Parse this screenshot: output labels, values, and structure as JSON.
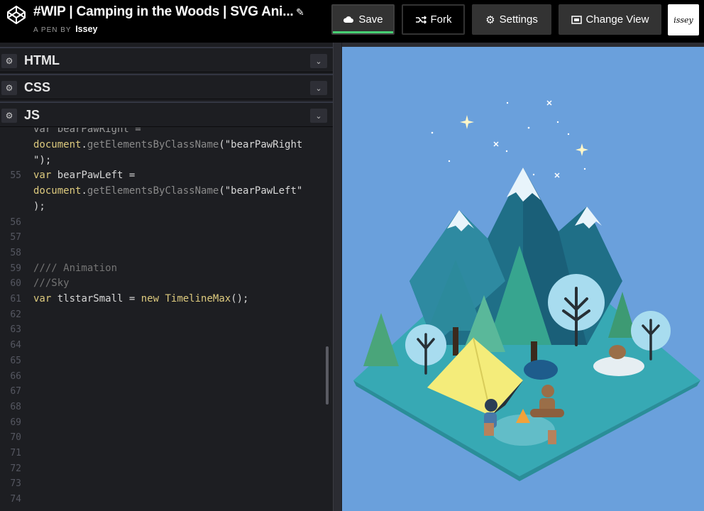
{
  "header": {
    "title": "#WIP | Camping in the Woods | SVG Ani...",
    "byline_prefix": "A PEN BY",
    "author": "Issey",
    "buttons": {
      "save": "Save",
      "fork": "Fork",
      "settings": "Settings",
      "change_view": "Change View"
    },
    "avatar_text": "issey"
  },
  "panels": {
    "html": "HTML",
    "css": "CSS",
    "js": "JS"
  },
  "code": {
    "lines": [
      {
        "num": "",
        "text": "document.getElementsByClassName(\"bearPawRight"
      },
      {
        "num": "",
        "text": "\");"
      },
      {
        "num": "55",
        "text": "var bearPawLeft ="
      },
      {
        "num": "",
        "text": "document.getElementsByClassName(\"bearPawLeft\""
      },
      {
        "num": "",
        "text": ");"
      },
      {
        "num": "56",
        "text": ""
      },
      {
        "num": "57",
        "text": ""
      },
      {
        "num": "58",
        "text": ""
      },
      {
        "num": "59",
        "text": "//// Animation"
      },
      {
        "num": "60",
        "text": "///Sky"
      },
      {
        "num": "61",
        "text": "var tlstarSmall = new TimelineMax();"
      },
      {
        "num": "62",
        "text": ""
      },
      {
        "num": "63",
        "text": ""
      },
      {
        "num": "64",
        "text": ""
      },
      {
        "num": "65",
        "text": ""
      },
      {
        "num": "66",
        "text": ""
      },
      {
        "num": "67",
        "text": ""
      },
      {
        "num": "68",
        "text": ""
      },
      {
        "num": "69",
        "text": ""
      },
      {
        "num": "70",
        "text": ""
      },
      {
        "num": "71",
        "text": ""
      },
      {
        "num": "72",
        "text": ""
      },
      {
        "num": "73",
        "text": ""
      },
      {
        "num": "74",
        "text": ""
      }
    ]
  },
  "colors": {
    "accent_green": "#47cf73",
    "sky": "#6aa0dc",
    "ground": "#35a8b1",
    "tent": "#f4ec7a"
  }
}
